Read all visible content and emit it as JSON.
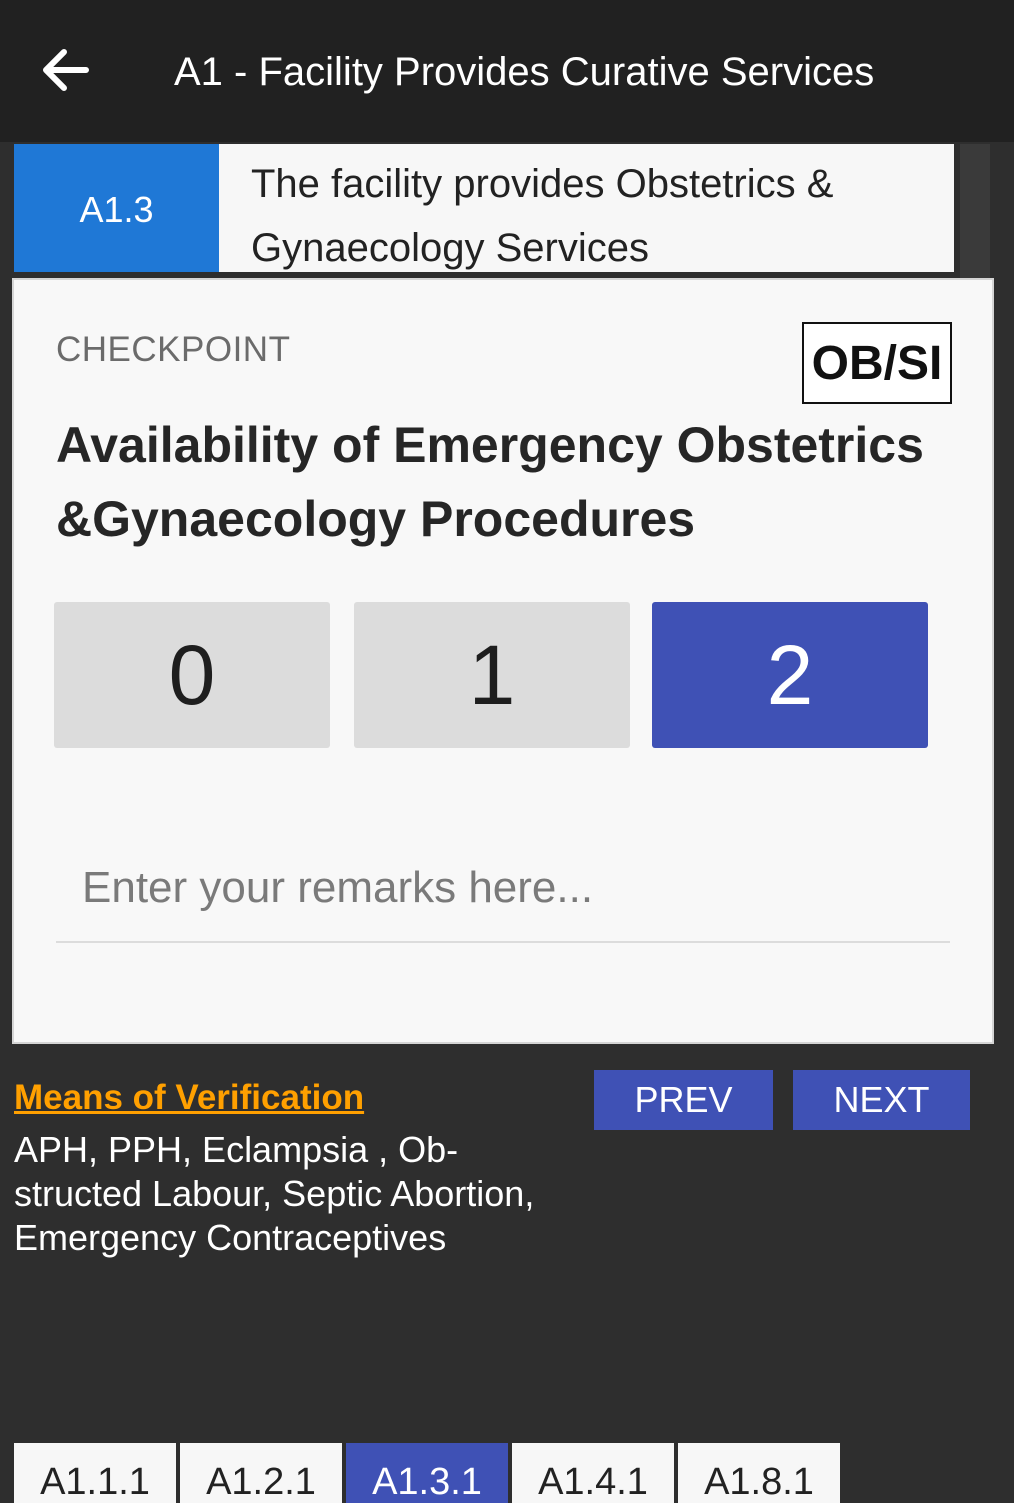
{
  "header": {
    "back_icon": "arrow-left-icon",
    "title": "A1 - Facility Provides Curative Services"
  },
  "standard": {
    "code": "A1.3",
    "text": "The facility provides Obstetrics & Gynaecology Services"
  },
  "checkpoint": {
    "label": "CHECKPOINT",
    "badge": "OB/SI",
    "title": "Availability of Emergency Obstetrics &Gynaecology Procedures",
    "scores": [
      "0",
      "1",
      "2"
    ],
    "selected_score": "2",
    "remarks_value": "",
    "remarks_placeholder": "Enter your remarks here..."
  },
  "verification": {
    "link_label": "Means of Verification",
    "text": "APH, PPH, Eclampsia , Ob-structed Labour, Septic Abortion, Emergency Contraceptives"
  },
  "nav": {
    "prev_label": "PREV",
    "next_label": "NEXT"
  },
  "tabs": {
    "items": [
      "A1.1.1",
      "A1.2.1",
      "A1.3.1",
      "A1.4.1",
      "A1.8.1"
    ],
    "active": "A1.3.1"
  },
  "colors": {
    "appbar": "#212121",
    "background": "#2e2e2e",
    "standard_code_bg": "#1f78d6",
    "accent": "#3f51b5",
    "link": "#ffa000"
  }
}
